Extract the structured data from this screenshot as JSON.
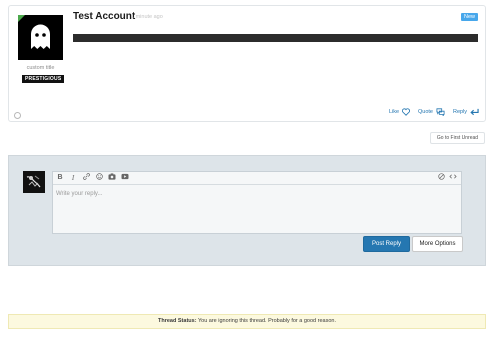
{
  "post": {
    "username": "Test Account",
    "time": "1 minute ago",
    "new_badge": "New",
    "custom_title": "custom title",
    "rank_badge": "PRESTIGIOUS",
    "actions": {
      "like": "Like",
      "quote": "Quote",
      "reply": "Reply"
    },
    "icons": [
      "heart-icon",
      "quote-bubble-icon",
      "reply-arrow-icon",
      "ghost-avatar-icon"
    ]
  },
  "go_to_first_unread": "Go to First Unread",
  "reply_editor": {
    "placeholder": "Write your reply...",
    "toolbar": [
      "bold-icon",
      "italic-icon",
      "link-icon",
      "smilie-icon",
      "image-icon",
      "media-icon",
      "eraser-icon",
      "code-icon"
    ],
    "post_reply_label": "Post Reply",
    "more_options_label": "More Options"
  },
  "thread_status": {
    "label": "Thread Status:",
    "text": "You are ignoring this thread. Probably for a good reason."
  },
  "colors": {
    "accent": "#2577b1",
    "new_badge": "#47a7eb",
    "status_bg": "#fcf9df",
    "reply_bg": "#dde4e9"
  }
}
